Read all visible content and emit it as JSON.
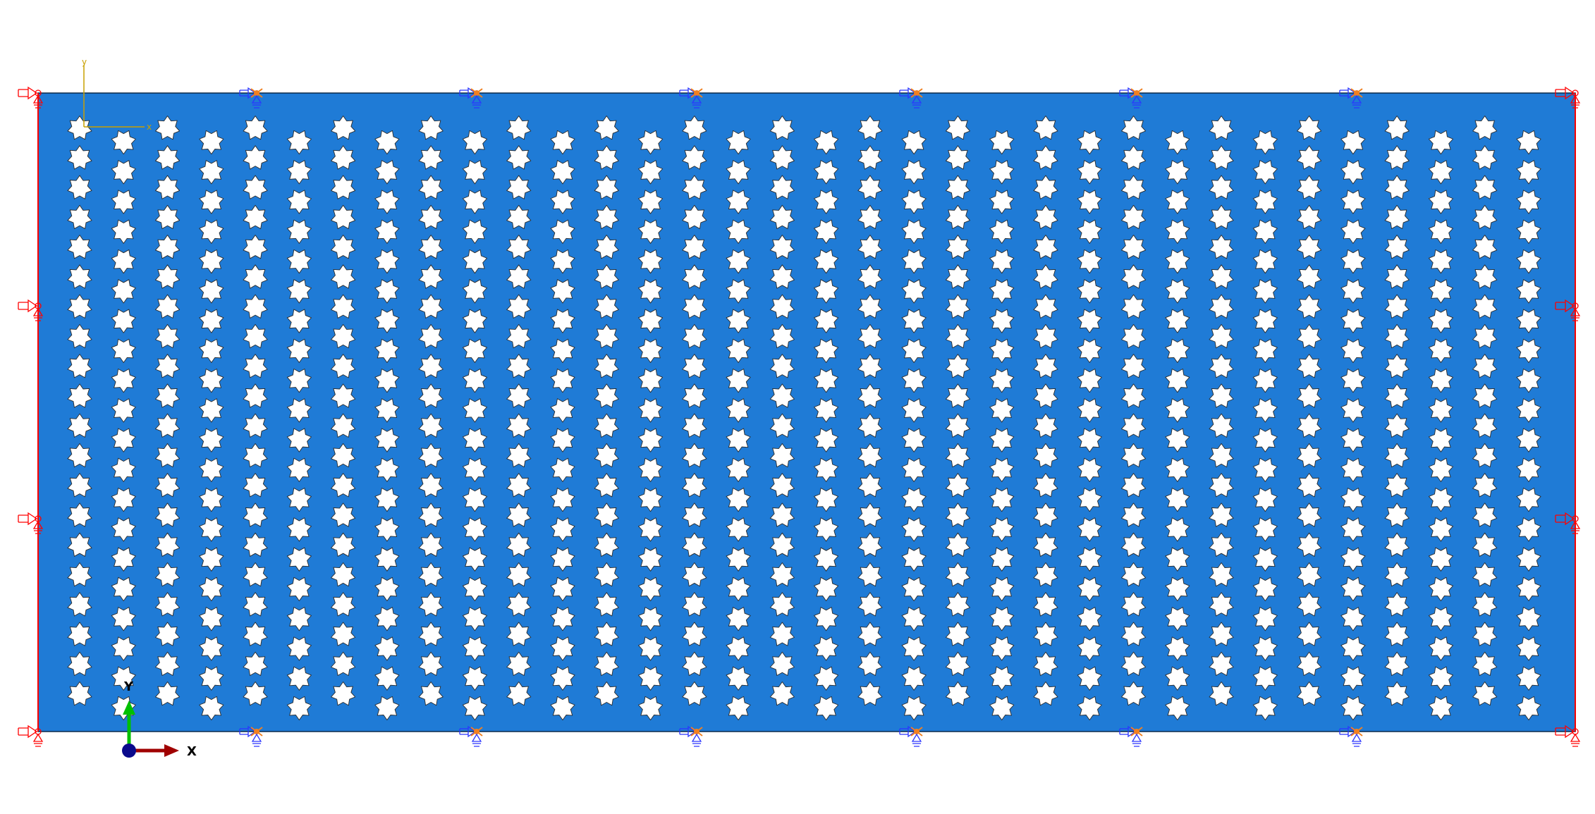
{
  "viewport": {
    "background": "#ffffff"
  },
  "model": {
    "plate_color": "#1f7bd6",
    "hole_color": "#ffffff",
    "hole_shape": "seven-point-star",
    "hole_columns": 34,
    "hole_rows": 20,
    "edge_line_color": "#ff0000"
  },
  "boundary_conditions": {
    "marker_color": "#ff0000",
    "roller_marker_color": "#f08020",
    "roller_arrow_color": "#2a35ff"
  },
  "sketch_triad": {
    "color": "#c8a000",
    "x_label": "x",
    "y_label": "y"
  },
  "view_triad": {
    "x_color": "#a00000",
    "y_color": "#00c000",
    "z_color": "#0a0a8c",
    "x_label": "X",
    "y_label": "Y"
  }
}
